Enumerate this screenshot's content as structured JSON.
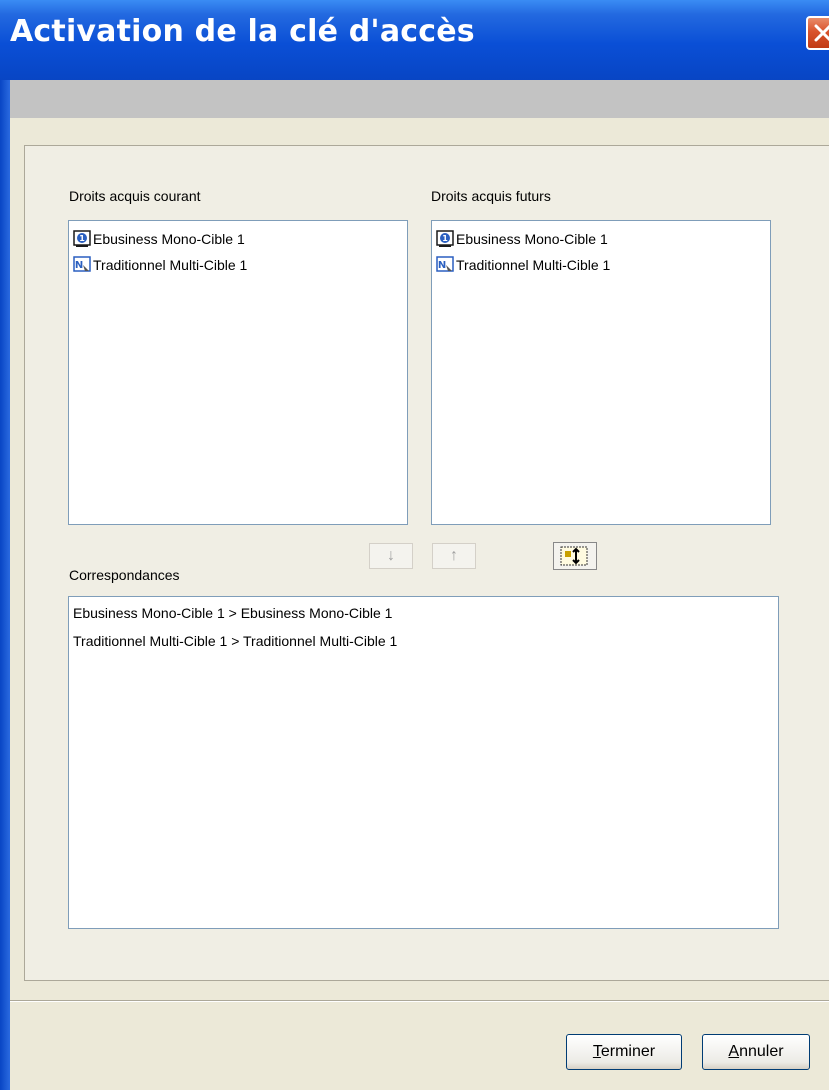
{
  "window": {
    "title": "Activation de la clé d'accès",
    "close_label": "X"
  },
  "current": {
    "label": "Droits acquis courant",
    "items": [
      {
        "label": "Ebusiness Mono-Cible 1",
        "icon": "mono-cible-icon"
      },
      {
        "label": "Traditionnel Multi-Cible 1",
        "icon": "multi-cible-icon"
      }
    ]
  },
  "future": {
    "label": "Droits acquis futurs",
    "items": [
      {
        "label": "Ebusiness Mono-Cible 1",
        "icon": "mono-cible-icon"
      },
      {
        "label": "Traditionnel Multi-Cible 1",
        "icon": "multi-cible-icon"
      }
    ]
  },
  "controls": {
    "down_arrow": "↓",
    "up_arrow": "↑",
    "map_icon": "auto-map-icon"
  },
  "correspondances": {
    "label": "Correspondances",
    "rows": [
      "Ebusiness Mono-Cible 1 > Ebusiness Mono-Cible 1",
      "Traditionnel Multi-Cible 1 > Traditionnel Multi-Cible 1"
    ]
  },
  "footer": {
    "finish_accel": "T",
    "finish_rest": "erminer",
    "cancel_accel": "A",
    "cancel_rest": "nnuler"
  },
  "colors": {
    "titlebar": "#0a4fd6",
    "close_button": "#d9532c",
    "dialog_bg": "#ece9d8",
    "list_border": "#7f9db9"
  }
}
